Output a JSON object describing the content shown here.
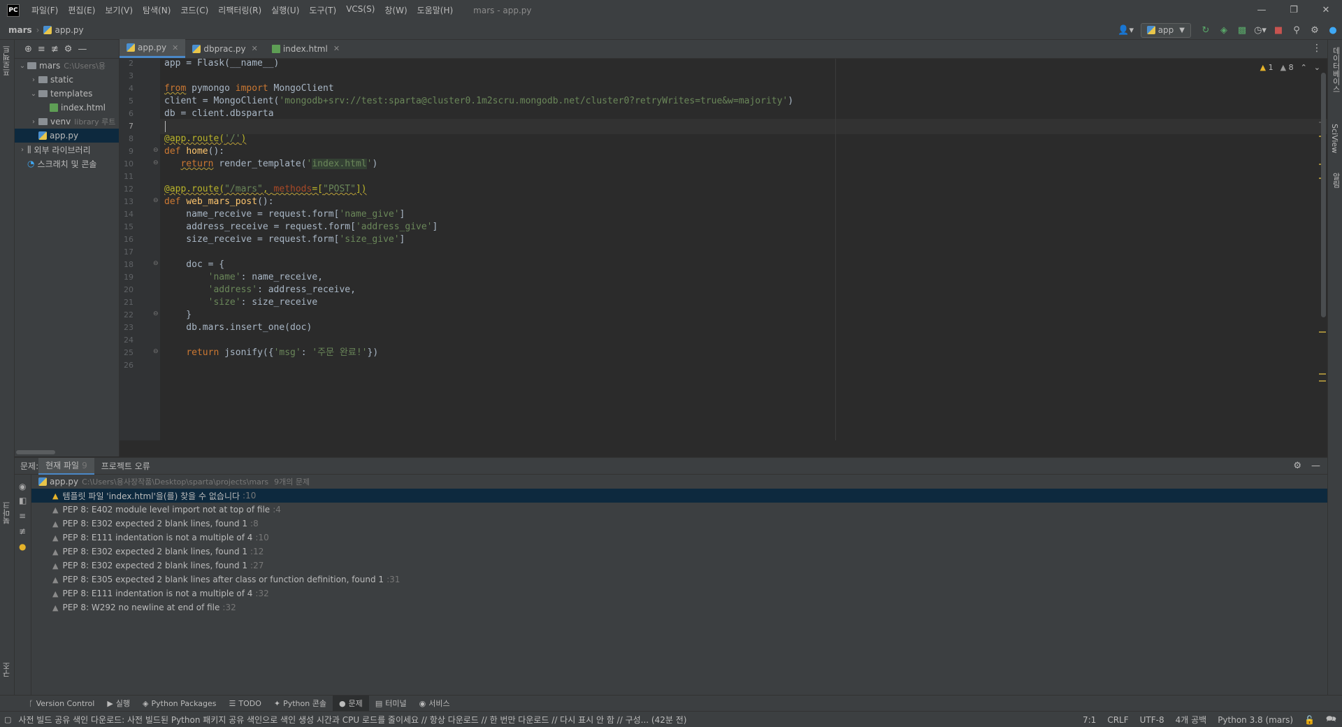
{
  "titlebar": {
    "logo": "PC",
    "menus": [
      "파일(F)",
      "편집(E)",
      "보기(V)",
      "탐색(N)",
      "코드(C)",
      "리팩터링(R)",
      "실행(U)",
      "도구(T)",
      "VCS(S)",
      "창(W)",
      "도움말(H)"
    ],
    "window_title": "mars - app.py"
  },
  "navbar": {
    "project": "mars",
    "file": "app.py",
    "run_config": "app"
  },
  "left_strip": {
    "top_tab": "프로젝트",
    "bookmark_tab": "북마크",
    "structure_tab": "구조"
  },
  "right_strip": {
    "tabs": [
      "데이터베이스",
      "SciView",
      "알림"
    ]
  },
  "project_tree": [
    {
      "label": "mars",
      "hint": "C:\\Users\\용",
      "level": 0,
      "type": "folder",
      "expanded": true
    },
    {
      "label": "static",
      "hint": "",
      "level": 1,
      "type": "folder",
      "expanded": false
    },
    {
      "label": "templates",
      "hint": "",
      "level": 1,
      "type": "folder",
      "expanded": true
    },
    {
      "label": "index.html",
      "hint": "",
      "level": 2,
      "type": "html"
    },
    {
      "label": "venv",
      "hint": "library 루트",
      "level": 1,
      "type": "folder",
      "expanded": false
    },
    {
      "label": "app.py",
      "hint": "",
      "level": 1,
      "type": "py",
      "selected": true
    },
    {
      "label": "외부 라이브러리",
      "hint": "",
      "level": 0,
      "type": "lib",
      "expanded": false
    },
    {
      "label": "스크래치 및 콘솔",
      "hint": "",
      "level": 0,
      "type": "scratch"
    }
  ],
  "editor_tabs": [
    {
      "label": "app.py",
      "type": "py",
      "active": true
    },
    {
      "label": "dbprac.py",
      "type": "py",
      "active": false
    },
    {
      "label": "index.html",
      "type": "html",
      "active": false
    }
  ],
  "inspection": {
    "warnings": "1",
    "weak_warnings": "8"
  },
  "code": {
    "current_line": 7,
    "lines": [
      {
        "n": 2,
        "html": "app = Flask(__name__)"
      },
      {
        "n": 3,
        "html": ""
      },
      {
        "n": 4,
        "html": "<span class=\"kw warn-underline\">from</span> pymongo <span class=\"kw\">import</span> MongoClient"
      },
      {
        "n": 5,
        "html": "client = MongoClient(<span class=\"str\">'mongodb+srv://test:sparta@cluster0.1m2scru.mongodb.net/cluster0?retryWrites=true&amp;w=majority'</span>)"
      },
      {
        "n": 6,
        "html": "db = client.dbsparta"
      },
      {
        "n": 7,
        "html": ""
      },
      {
        "n": 8,
        "html": "<span class=\"dec warn-underline\">@app.route(<span class=\"str\">'/'</span>)</span>"
      },
      {
        "n": 9,
        "html": "<span class=\"kw\">def</span> <span class=\"fn\">home</span>():"
      },
      {
        "n": 10,
        "html": "   <span class=\"kw warn-underline\">return</span> render_template(<span class=\"str\">'<span class=\"str-hl\">index.html</span>'</span>)"
      },
      {
        "n": 11,
        "html": ""
      },
      {
        "n": 12,
        "html": "<span class=\"dec warn-underline\">@app.route(<span class=\"str\">\"/mars\"</span>, <span class=\"param\">methods</span>=[<span class=\"str\">\"POST\"</span>])</span>"
      },
      {
        "n": 13,
        "html": "<span class=\"kw\">def</span> <span class=\"fn\">web_mars_post</span>():"
      },
      {
        "n": 14,
        "html": "    name_receive = request.form[<span class=\"str\">'name_give'</span>]"
      },
      {
        "n": 15,
        "html": "    address_receive = request.form[<span class=\"str\">'address_give'</span>]"
      },
      {
        "n": 16,
        "html": "    size_receive = request.form[<span class=\"str\">'size_give'</span>]"
      },
      {
        "n": 17,
        "html": ""
      },
      {
        "n": 18,
        "html": "    doc = {"
      },
      {
        "n": 19,
        "html": "        <span class=\"str\">'name'</span>: name_receive,"
      },
      {
        "n": 20,
        "html": "        <span class=\"str\">'address'</span>: address_receive,"
      },
      {
        "n": 21,
        "html": "        <span class=\"str\">'size'</span>: size_receive"
      },
      {
        "n": 22,
        "html": "    }"
      },
      {
        "n": 23,
        "html": "    db.mars.insert_one(doc)"
      },
      {
        "n": 24,
        "html": ""
      },
      {
        "n": 25,
        "html": "    <span class=\"kw\">return</span> jsonify({<span class=\"str\">'msg'</span>: <span class=\"str\">'주문 완료!'</span>})"
      },
      {
        "n": 26,
        "html": ""
      }
    ]
  },
  "problems": {
    "label": "문제:",
    "tab_current": "현재 파일",
    "tab_current_count": "9",
    "tab_project": "프로젝트 오류",
    "file_name": "app.py",
    "file_path": "C:\\Users\\용사장작품\\Desktop\\sparta\\projects\\mars",
    "file_count": "9개의 문제",
    "items": [
      {
        "text": "템플릿 파일 'index.html'을(를) 찾을 수 없습니다",
        "line": ":10",
        "severity": "warning",
        "selected": true
      },
      {
        "text": "PEP 8: E402 module level import not at top of file",
        "line": ":4",
        "severity": "weak"
      },
      {
        "text": "PEP 8: E302 expected 2 blank lines, found 1",
        "line": ":8",
        "severity": "weak"
      },
      {
        "text": "PEP 8: E111 indentation is not a multiple of 4",
        "line": ":10",
        "severity": "weak"
      },
      {
        "text": "PEP 8: E302 expected 2 blank lines, found 1",
        "line": ":12",
        "severity": "weak"
      },
      {
        "text": "PEP 8: E302 expected 2 blank lines, found 1",
        "line": ":27",
        "severity": "weak"
      },
      {
        "text": "PEP 8: E305 expected 2 blank lines after class or function definition, found 1",
        "line": ":31",
        "severity": "weak"
      },
      {
        "text": "PEP 8: E111 indentation is not a multiple of 4",
        "line": ":32",
        "severity": "weak"
      },
      {
        "text": "PEP 8: W292 no newline at end of file",
        "line": ":32",
        "severity": "weak"
      }
    ]
  },
  "bottom_toolbar": [
    {
      "label": "Version Control",
      "icon": "branch-icon"
    },
    {
      "label": "실행",
      "icon": "run-icon"
    },
    {
      "label": "Python Packages",
      "icon": "packages-icon"
    },
    {
      "label": "TODO",
      "icon": "todo-icon"
    },
    {
      "label": "Python 콘솔",
      "icon": "python-console-icon"
    },
    {
      "label": "문제",
      "icon": "problems-icon",
      "active": true
    },
    {
      "label": "터미널",
      "icon": "terminal-icon"
    },
    {
      "label": "서비스",
      "icon": "services-icon"
    }
  ],
  "statusbar": {
    "message": "사전 빌드 공유 색인 다운로드: 사전 빌드된 Python 패키지 공유 색인으로 색인 생성 시간과 CPU 로드를 줄이세요 // 항상 다운로드 // 한 번만 다운로드 // 다시 표시 안 함 // 구성... (42분 전)",
    "position": "7:1",
    "line_sep": "CRLF",
    "encoding": "UTF-8",
    "indent": "4개 공백",
    "interpreter": "Python 3.8 (mars)"
  }
}
